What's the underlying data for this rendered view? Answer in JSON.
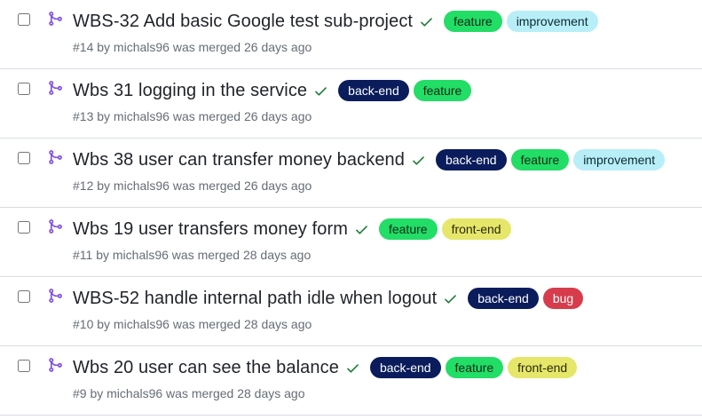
{
  "colors": {
    "feature": {
      "bg": "#22dd66",
      "fg": "#0d2a16"
    },
    "improvement": {
      "bg": "#b8eef8",
      "fg": "#0b2a33"
    },
    "back-end": {
      "bg": "#0a1c5c",
      "fg": "#ffffff"
    },
    "front-end": {
      "bg": "#e6e66a",
      "fg": "#2a2a08"
    },
    "bug": {
      "bg": "#d63c4c",
      "fg": "#ffffff"
    },
    "merge_icon": "#8250df",
    "check_icon": "#1a7f37"
  },
  "pull_requests": [
    {
      "title": "WBS-32 Add basic Google test sub-project",
      "meta": "#14 by michals96 was merged 26 days ago",
      "labels": [
        "feature",
        "improvement"
      ]
    },
    {
      "title": "Wbs 31 logging in the service",
      "meta": "#13 by michals96 was merged 26 days ago",
      "labels": [
        "back-end",
        "feature"
      ]
    },
    {
      "title": "Wbs 38 user can transfer money backend",
      "meta": "#12 by michals96 was merged 26 days ago",
      "labels": [
        "back-end",
        "feature",
        "improvement"
      ]
    },
    {
      "title": "Wbs 19 user transfers money form",
      "meta": "#11 by michals96 was merged 28 days ago",
      "labels": [
        "feature",
        "front-end"
      ]
    },
    {
      "title": "WBS-52 handle internal path idle when logout",
      "meta": "#10 by michals96 was merged 28 days ago",
      "labels": [
        "back-end",
        "bug"
      ]
    },
    {
      "title": "Wbs 20 user can see the balance",
      "meta": "#9 by michals96 was merged 28 days ago",
      "labels": [
        "back-end",
        "feature",
        "front-end"
      ]
    }
  ]
}
